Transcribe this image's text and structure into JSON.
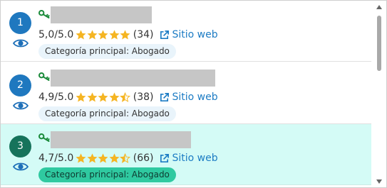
{
  "results": [
    {
      "rank": "1",
      "score": "5,0/5.0",
      "stars": [
        "full",
        "full",
        "full",
        "full",
        "full"
      ],
      "review_count": "(34)",
      "website_label": "Sitio web",
      "category": "Categoría principal: Abogado",
      "selected": false
    },
    {
      "rank": "2",
      "score": "4,9/5.0",
      "stars": [
        "full",
        "full",
        "full",
        "full",
        "half"
      ],
      "review_count": "(38)",
      "website_label": "Sitio web",
      "category": "Categoría principal: Abogado",
      "selected": false
    },
    {
      "rank": "3",
      "score": "4,7/5.0",
      "stars": [
        "full",
        "full",
        "full",
        "full",
        "half"
      ],
      "review_count": "(66)",
      "website_label": "Sitio web",
      "category": "Categoría principal: Abogado",
      "selected": true
    }
  ],
  "icons": {
    "key": "key-icon",
    "eye": "eye-icon",
    "star": "star-icon",
    "external": "external-link-icon"
  },
  "colors": {
    "rank_badge": "#1f78bf",
    "rank_badge_selected": "#16735b",
    "selected_row": "#d4fbf6",
    "category_pill": "#e9f4fb",
    "category_pill_selected": "#2fc9a0",
    "link": "#1d7cc4",
    "star": "#f5b523",
    "key": "#1a8a3a"
  },
  "scrollbar": {
    "position_fraction": 0.0
  }
}
